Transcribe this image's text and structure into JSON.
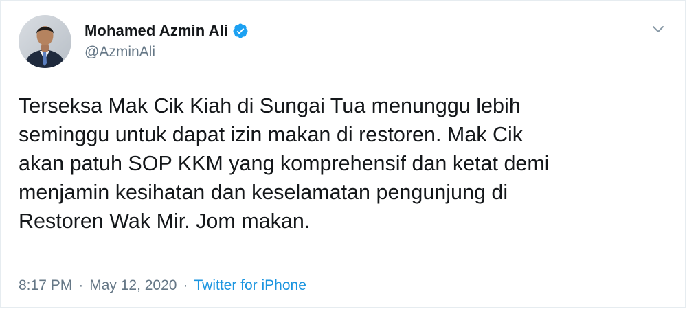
{
  "tweet": {
    "display_name": "Mohamed Azmin Ali",
    "handle": "@AzminAli",
    "verified": true,
    "text": "Terseksa Mak Cik Kiah di Sungai Tua menunggu lebih\nseminggu untuk dapat izin makan di restoren. Mak Cik\nakan patuh SOP KKM yang komprehensif dan ketat demi\nmenjamin kesihatan dan keselamatan pengunjung di\nRestoren Wak Mir. Jom makan.",
    "time": "8:17 PM",
    "date": "May 12, 2020",
    "separator": "·",
    "source": "Twitter for iPhone"
  },
  "icons": {
    "verified": "verified-badge-icon",
    "more": "chevron-down-icon"
  },
  "colors": {
    "text_primary": "#14171a",
    "text_secondary": "#657786",
    "link": "#1b95e0",
    "verified": "#1da1f2",
    "border": "#e6ecf0"
  }
}
